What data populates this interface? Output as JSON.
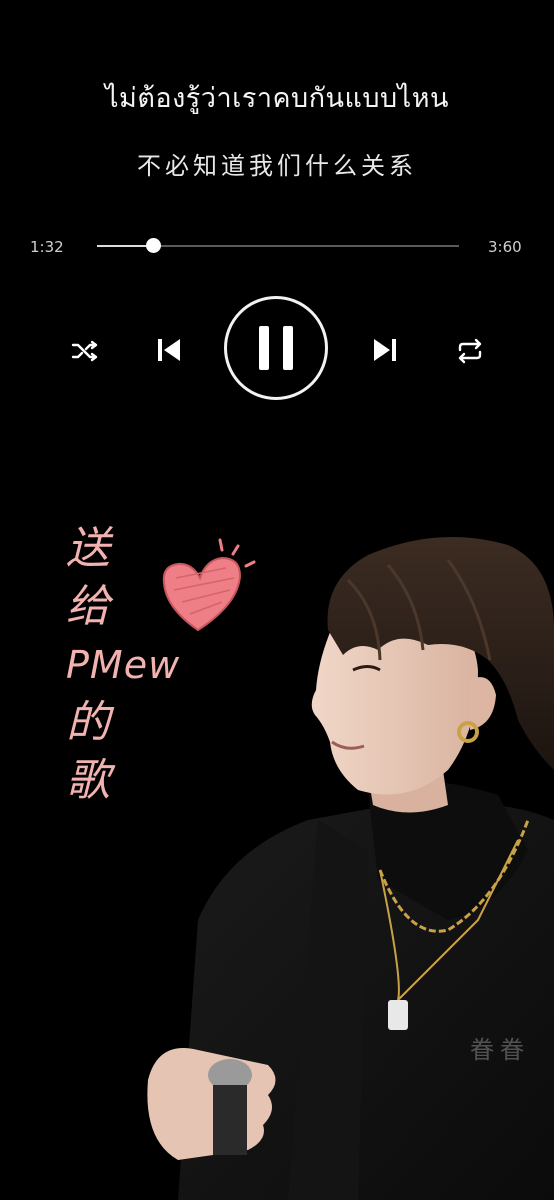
{
  "lyrics": {
    "current": "ไม่ต้องรู้ว่าเราคบกันแบบไหน",
    "translation": "不必知道我们什么关系"
  },
  "player": {
    "elapsed": "1:32",
    "total": "3:60",
    "progress_fraction": 0.155,
    "state": "playing"
  },
  "controls": {
    "shuffle_icon": "shuffle-icon",
    "previous_icon": "skip-previous-icon",
    "pause_icon": "pause-icon",
    "next_icon": "skip-next-icon",
    "repeat_icon": "repeat-icon"
  },
  "dedication": {
    "line1": "送",
    "line2": "给",
    "line3": "PMew",
    "line4": "的",
    "line5": "歌"
  },
  "watermark": "眷眷",
  "colors": {
    "background": "#000000",
    "accent_pink": "#f2b3b0",
    "heart_pink": "#ee7f86"
  }
}
